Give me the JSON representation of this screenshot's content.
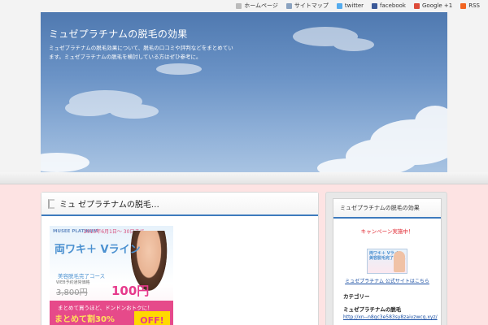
{
  "toplinks": [
    {
      "label": "ホームページ",
      "icon": "home-icon"
    },
    {
      "label": "サイトマップ",
      "icon": "sitemap-icon"
    },
    {
      "label": "twitter",
      "icon": "twitter-icon"
    },
    {
      "label": "facebook",
      "icon": "facebook-icon"
    },
    {
      "label": "Google +1",
      "icon": "google-plus-icon"
    },
    {
      "label": "RSS",
      "icon": "rss-icon"
    }
  ],
  "header": {
    "title": "ミュゼプラチナムの脱毛の効果",
    "description": "ミュゼプラチナムの脱毛効果について、脱毛の口コミや評判などをまとめています。ミュゼプラチナムの脱毛を検討している方はぜひ参考に。"
  },
  "main": {
    "post_title": "ミュ ゼプラチナムの脱毛…",
    "ad": {
      "logo": "MUSEE PLATINUM",
      "date": "2015年6月1日～ 30日まで",
      "headline": "両ワキ＋ Vライン",
      "subline": "美容脱毛完了コース",
      "web_note": "WEB予約通常価格",
      "old_price": "3,800円",
      "price": "100円",
      "band_top": "まとめて買うほど、ドンドンおトクに！",
      "band_big": "まとめて割30%",
      "off_label": "OFF!"
    }
  },
  "sidebar": {
    "title": "ミュゼプラチナムの脱毛の効果",
    "red_text": "キャンペーン実施中！",
    "thumb_text": "両ワキ＋ Vライン 美容脱毛完了コース",
    "thumb_link": "ミュゼプラチナム 公式サイトはこちら",
    "label1": "カテゴリー",
    "label2": "ミュゼプラチナムの脱毛",
    "url": "http://xn--n8gc3e583sy8zaivzwcg.xyz/"
  },
  "colors": {
    "accent": "#3e7bbd",
    "background": "#fde3e3",
    "red": "#e0262f",
    "link": "#1a4fa3"
  }
}
